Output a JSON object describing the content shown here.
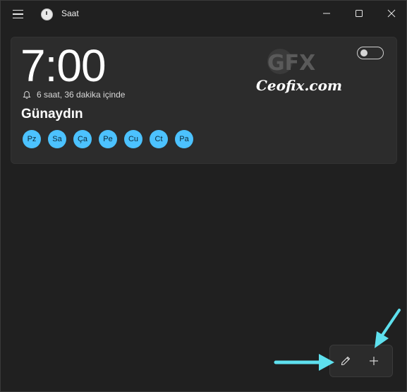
{
  "window": {
    "title": "Saat",
    "icons": {
      "menu": "hamburger-icon",
      "app": "clock-app-icon",
      "minimize": "minimize-icon",
      "maximize": "maximize-icon",
      "close": "close-icon"
    }
  },
  "alarm": {
    "time": "7:00",
    "remaining": "6 saat, 36 dakika içinde",
    "name": "Günaydın",
    "enabled": false,
    "days": [
      "Pz",
      "Sa",
      "Ça",
      "Pe",
      "Cu",
      "Ct",
      "Pa"
    ],
    "day_color": "#4cc2ff"
  },
  "watermark": {
    "logo_text": "GFX",
    "site": "Ceofix.com"
  },
  "command_bar": {
    "edit_icon": "pencil-icon",
    "add_icon": "plus-icon"
  },
  "annotations": {
    "arrow_color": "#5ee0ee"
  }
}
